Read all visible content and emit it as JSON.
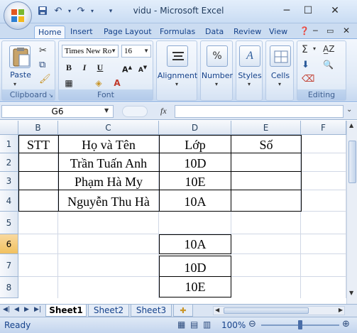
{
  "window": {
    "title": "vidu - Microsoft Excel"
  },
  "tabs": [
    "Home",
    "Insert",
    "Page Layout",
    "Formulas",
    "Data",
    "Review",
    "View"
  ],
  "ribbon": {
    "clipboard": {
      "paste_label": "Paste",
      "group_label": "Clipboard"
    },
    "font": {
      "font_name": "Times New Ro",
      "font_size": "16",
      "group_label": "Font"
    },
    "alignment_label": "Alignment",
    "number_label": "Number",
    "styles_label": "Styles",
    "cells_label": "Cells",
    "editing_label": "Editing"
  },
  "formula_bar": {
    "name_box": "G6",
    "fx": "fx",
    "formula": ""
  },
  "columns": [
    "B",
    "C",
    "D",
    "E",
    "F"
  ],
  "rows": [
    "1",
    "2",
    "3",
    "4",
    "5",
    "6",
    "7",
    "8"
  ],
  "cells": {
    "B1": "STT",
    "C1": "Họ và Tên",
    "D1": "Lớp",
    "E1": "Số",
    "C2": "Trần Tuấn Anh",
    "D2": "10D",
    "C3": "Phạm Hà My",
    "D3": "10E",
    "C4": "Nguyễn Thu Hà",
    "D4": "10A",
    "D6": "10A",
    "D7": "10D",
    "D8": "10E"
  },
  "sheets": [
    "Sheet1",
    "Sheet2",
    "Sheet3"
  ],
  "active_sheet": "Sheet1",
  "status": {
    "text": "Ready",
    "zoom": "100%"
  },
  "colors": {
    "accent": "#15428b",
    "ribbon_bg": "#dde8f6",
    "selected_header": "#f1c15f"
  }
}
